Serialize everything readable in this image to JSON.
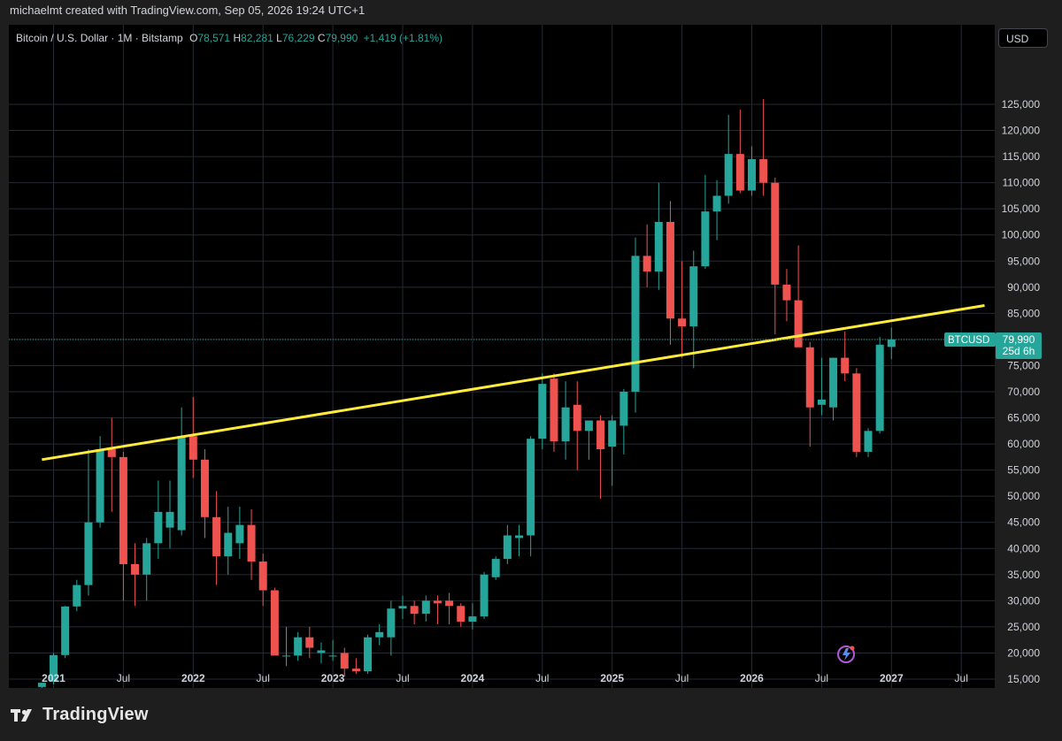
{
  "attribution": "michaelmt created with TradingView.com, Sep 05, 2026 19:24 UTC+1",
  "legend": {
    "symbol": "Bitcoin / U.S. Dollar · 1M · Bitstamp",
    "o_label": "O",
    "o_value": "78,571",
    "h_label": "H",
    "h_value": "82,281",
    "l_label": "L",
    "l_value": "76,229",
    "c_label": "C",
    "c_value": "79,990",
    "change": "+1,419 (+1.81%)"
  },
  "currency_button": "USD",
  "brand": "TradingView",
  "price_tag": {
    "symbol": "BTCUSD",
    "price": "79,990",
    "countdown": "25d 6h"
  },
  "colors": {
    "up": "#26a69a",
    "down": "#ef5350",
    "trendline": "#ffeb3b",
    "grid": "#262a36",
    "axis_text": "#d1d4dc"
  },
  "chart_data": {
    "type": "candlestick",
    "x_ticks": [
      "2021",
      "Jul",
      "2022",
      "Jul",
      "2023",
      "Jul",
      "2024",
      "Jul",
      "2025",
      "Jul",
      "2026",
      "Jul",
      "2027",
      "Jul"
    ],
    "y_ticks": [
      15000,
      20000,
      25000,
      30000,
      35000,
      40000,
      45000,
      50000,
      55000,
      60000,
      65000,
      70000,
      75000,
      80000,
      85000,
      90000,
      95000,
      100000,
      105000,
      110000,
      115000,
      120000,
      125000
    ],
    "ylim": [
      12000,
      129000
    ],
    "trendline": {
      "start": [
        "2020-12",
        57000
      ],
      "end": [
        "2027-09",
        86500
      ]
    },
    "last_price": 79990,
    "candles": [
      {
        "t": "2020-12",
        "o": 13500,
        "h": 14300,
        "l": 13300,
        "c": 14300
      },
      {
        "t": "2021-01",
        "o": 14500,
        "h": 20000,
        "l": 14000,
        "c": 19600
      },
      {
        "t": "2021-02",
        "o": 19600,
        "h": 29000,
        "l": 19000,
        "c": 28900
      },
      {
        "t": "2021-03",
        "o": 28900,
        "h": 34000,
        "l": 28000,
        "c": 33000
      },
      {
        "t": "2021-04",
        "o": 33000,
        "h": 59000,
        "l": 31000,
        "c": 45000
      },
      {
        "t": "2021-05",
        "o": 45000,
        "h": 61500,
        "l": 44000,
        "c": 59000
      },
      {
        "t": "2021-06",
        "o": 59000,
        "h": 65000,
        "l": 47000,
        "c": 57500
      },
      {
        "t": "2021-07",
        "o": 57500,
        "h": 58500,
        "l": 30000,
        "c": 37000
      },
      {
        "t": "2021-08",
        "o": 37000,
        "h": 41000,
        "l": 29000,
        "c": 35000
      },
      {
        "t": "2021-09",
        "o": 35000,
        "h": 42000,
        "l": 30000,
        "c": 41000
      },
      {
        "t": "2021-10",
        "o": 41000,
        "h": 53000,
        "l": 38000,
        "c": 47000
      },
      {
        "t": "2021-11",
        "o": 44000,
        "h": 53000,
        "l": 40000,
        "c": 47000
      },
      {
        "t": "2021-12",
        "o": 43500,
        "h": 67000,
        "l": 42500,
        "c": 61500
      },
      {
        "t": "2022-01",
        "o": 61500,
        "h": 69000,
        "l": 53500,
        "c": 57000
      },
      {
        "t": "2022-02",
        "o": 57000,
        "h": 59000,
        "l": 42000,
        "c": 46000
      },
      {
        "t": "2022-03",
        "o": 46000,
        "h": 51000,
        "l": 33000,
        "c": 38500
      },
      {
        "t": "2022-04",
        "o": 38500,
        "h": 48000,
        "l": 35000,
        "c": 43000
      },
      {
        "t": "2022-05",
        "o": 41000,
        "h": 48000,
        "l": 38000,
        "c": 44500
      },
      {
        "t": "2022-06",
        "o": 44500,
        "h": 47500,
        "l": 34000,
        "c": 37500
      },
      {
        "t": "2022-07",
        "o": 37500,
        "h": 39000,
        "l": 29000,
        "c": 32000
      },
      {
        "t": "2022-08",
        "o": 32000,
        "h": 32500,
        "l": 20000,
        "c": 19500
      },
      {
        "t": "2022-09",
        "o": 19500,
        "h": 25000,
        "l": 17500,
        "c": 19500
      },
      {
        "t": "2022-10",
        "o": 19500,
        "h": 24000,
        "l": 18500,
        "c": 23000
      },
      {
        "t": "2022-11",
        "o": 23000,
        "h": 25000,
        "l": 19000,
        "c": 21000
      },
      {
        "t": "2022-12",
        "o": 20000,
        "h": 22000,
        "l": 18000,
        "c": 20500
      },
      {
        "t": "2023-01",
        "o": 19500,
        "h": 22500,
        "l": 18500,
        "c": 19500
      },
      {
        "t": "2023-02",
        "o": 20000,
        "h": 21000,
        "l": 15500,
        "c": 17000
      },
      {
        "t": "2023-03",
        "o": 17000,
        "h": 19000,
        "l": 16000,
        "c": 16500
      },
      {
        "t": "2023-04",
        "o": 16500,
        "h": 23500,
        "l": 16000,
        "c": 23000
      },
      {
        "t": "2023-05",
        "o": 23000,
        "h": 25500,
        "l": 21500,
        "c": 24000
      },
      {
        "t": "2023-06",
        "o": 23000,
        "h": 30000,
        "l": 19500,
        "c": 28500
      },
      {
        "t": "2023-07",
        "o": 28500,
        "h": 31000,
        "l": 26500,
        "c": 29000
      },
      {
        "t": "2023-08",
        "o": 29000,
        "h": 30000,
        "l": 25500,
        "c": 27500
      },
      {
        "t": "2023-09",
        "o": 27500,
        "h": 31000,
        "l": 26000,
        "c": 30000
      },
      {
        "t": "2023-10",
        "o": 30000,
        "h": 31000,
        "l": 25500,
        "c": 29500
      },
      {
        "t": "2023-11",
        "o": 30000,
        "h": 31500,
        "l": 25500,
        "c": 29000
      },
      {
        "t": "2023-12",
        "o": 29000,
        "h": 29500,
        "l": 25000,
        "c": 26000
      },
      {
        "t": "2024-01",
        "o": 26000,
        "h": 29500,
        "l": 24500,
        "c": 27000
      },
      {
        "t": "2024-02",
        "o": 27000,
        "h": 35500,
        "l": 26500,
        "c": 35000
      },
      {
        "t": "2024-03",
        "o": 34500,
        "h": 38500,
        "l": 34000,
        "c": 38000
      },
      {
        "t": "2024-04",
        "o": 38000,
        "h": 44500,
        "l": 37000,
        "c": 42500
      },
      {
        "t": "2024-05",
        "o": 42000,
        "h": 44500,
        "l": 38500,
        "c": 42500
      },
      {
        "t": "2024-06",
        "o": 42500,
        "h": 61500,
        "l": 38500,
        "c": 61000
      },
      {
        "t": "2024-07",
        "o": 61000,
        "h": 73500,
        "l": 59000,
        "c": 71500
      },
      {
        "t": "2024-08",
        "o": 72500,
        "h": 73500,
        "l": 58500,
        "c": 60500
      },
      {
        "t": "2024-09",
        "o": 60500,
        "h": 72000,
        "l": 57000,
        "c": 67000
      },
      {
        "t": "2024-10",
        "o": 67500,
        "h": 72000,
        "l": 55000,
        "c": 62500
      },
      {
        "t": "2024-11",
        "o": 62500,
        "h": 64000,
        "l": 57000,
        "c": 64500
      },
      {
        "t": "2024-12",
        "o": 64500,
        "h": 65500,
        "l": 49500,
        "c": 59000
      },
      {
        "t": "2025-01",
        "o": 59500,
        "h": 65500,
        "l": 52000,
        "c": 64500
      },
      {
        "t": "2025-02",
        "o": 63500,
        "h": 70500,
        "l": 58000,
        "c": 70000
      },
      {
        "t": "2025-03",
        "o": 70000,
        "h": 99500,
        "l": 66000,
        "c": 96000
      },
      {
        "t": "2025-04",
        "o": 96000,
        "h": 102000,
        "l": 90000,
        "c": 93000
      },
      {
        "t": "2025-05",
        "o": 93000,
        "h": 110000,
        "l": 89500,
        "c": 102500
      },
      {
        "t": "2025-06",
        "o": 102500,
        "h": 106500,
        "l": 79000,
        "c": 84000
      },
      {
        "t": "2025-07",
        "o": 84000,
        "h": 95000,
        "l": 76500,
        "c": 82500
      },
      {
        "t": "2025-08",
        "o": 82500,
        "h": 97000,
        "l": 74500,
        "c": 94000
      },
      {
        "t": "2025-09",
        "o": 94000,
        "h": 111500,
        "l": 93500,
        "c": 104500
      },
      {
        "t": "2025-10",
        "o": 104500,
        "h": 110500,
        "l": 99000,
        "c": 107500
      },
      {
        "t": "2025-11",
        "o": 107500,
        "h": 123000,
        "l": 106000,
        "c": 115500
      },
      {
        "t": "2025-12",
        "o": 115500,
        "h": 124000,
        "l": 108000,
        "c": 108500
      },
      {
        "t": "2026-01",
        "o": 108500,
        "h": 117000,
        "l": 107500,
        "c": 114500
      },
      {
        "t": "2026-02",
        "o": 114500,
        "h": 126000,
        "l": 107500,
        "c": 110000
      },
      {
        "t": "2026-03",
        "o": 110000,
        "h": 111000,
        "l": 81000,
        "c": 90500
      },
      {
        "t": "2026-04",
        "o": 90500,
        "h": 93500,
        "l": 83500,
        "c": 87500
      },
      {
        "t": "2026-05",
        "o": 87500,
        "h": 98000,
        "l": 79000,
        "c": 78500
      },
      {
        "t": "2026-06",
        "o": 78500,
        "h": 79500,
        "l": 59500,
        "c": 67000
      },
      {
        "t": "2026-07",
        "o": 67500,
        "h": 76500,
        "l": 65500,
        "c": 68500
      },
      {
        "t": "2026-08",
        "o": 67000,
        "h": 76500,
        "l": 64500,
        "c": 76500
      },
      {
        "t": "2026-09",
        "o": 76500,
        "h": 81500,
        "l": 72000,
        "c": 73500
      },
      {
        "t": "2026-10",
        "o": 73500,
        "h": 74500,
        "l": 57500,
        "c": 58500
      },
      {
        "t": "2026-11",
        "o": 58500,
        "h": 63000,
        "l": 57500,
        "c": 62500
      },
      {
        "t": "2026-12",
        "o": 62500,
        "h": 80500,
        "l": 62000,
        "c": 79000
      },
      {
        "t": "2027-01",
        "o": 78571,
        "h": 82281,
        "l": 76229,
        "c": 79990
      }
    ]
  }
}
